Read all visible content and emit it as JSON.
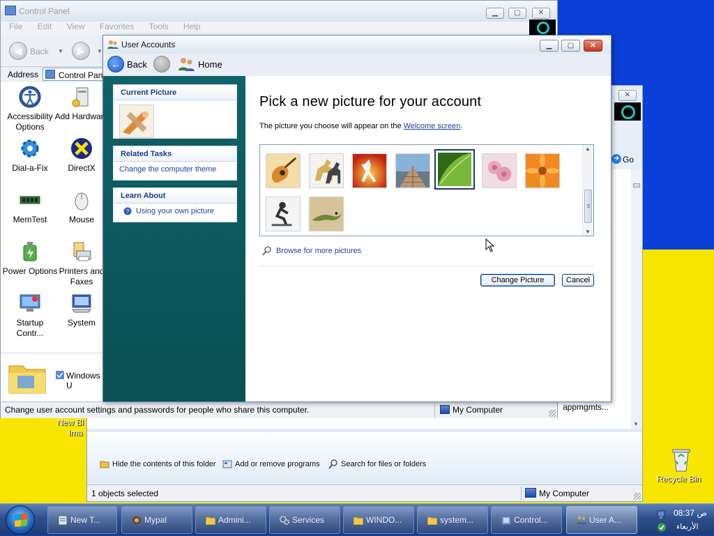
{
  "colors": {
    "desktop_top": "#0a3fd8",
    "desktop_bottom": "#f8e600",
    "sidebar_teal": "#0f6268",
    "link_blue": "#1f3f9a",
    "taskbar": "#2e4f8c"
  },
  "control_panel": {
    "title": "Control Panel",
    "menu": [
      "File",
      "Edit",
      "View",
      "Favorites",
      "Tools",
      "Help"
    ],
    "back_label": "Back",
    "address_label": "Address",
    "address_value": "Control Pan",
    "items": [
      {
        "label": "Accessibility Options",
        "icon": "accessibility-icon"
      },
      {
        "label": "Add Hardware",
        "icon": "add-hardware-icon"
      },
      {
        "label": "Dial-a-Fix",
        "icon": "dial-a-fix-icon"
      },
      {
        "label": "DirectX",
        "icon": "directx-icon"
      },
      {
        "label": "MemTest",
        "icon": "memtest-icon"
      },
      {
        "label": "Mouse",
        "icon": "mouse-icon"
      },
      {
        "label": "Power Options",
        "icon": "power-options-icon"
      },
      {
        "label": "Printers and Faxes",
        "icon": "printers-icon"
      },
      {
        "label": "Startup Contr...",
        "icon": "startup-icon"
      },
      {
        "label": "System",
        "icon": "system-icon"
      }
    ],
    "bottom_item": "Windows U",
    "status_text": "Change user account settings and passwords for people who share this computer.",
    "status_location": "My Computer"
  },
  "background_window": {
    "go_label": "Go",
    "list_item": "appmgmts...",
    "tasks": [
      {
        "label": "Hide the contents of this folder",
        "icon": "folder-icon"
      },
      {
        "label": "Add or remove programs",
        "icon": "programs-icon"
      },
      {
        "label": "Search for files or folders",
        "icon": "search-icon"
      }
    ],
    "status_text": "1 objects selected",
    "status_location": "My Computer"
  },
  "user_accounts": {
    "title": "User Accounts",
    "nav": {
      "back": "Back",
      "home": "Home"
    },
    "sidebar": {
      "current_picture_header": "Current Picture",
      "related_tasks_header": "Related Tasks",
      "related_tasks": [
        "Change the computer theme"
      ],
      "learn_about_header": "Learn About",
      "learn_about": [
        "Using your own picture"
      ]
    },
    "heading": "Pick a new picture for your account",
    "description_before": "The picture you choose will appear on the ",
    "description_link": "Welcome screen",
    "description_after": ".",
    "pictures": [
      {
        "name": "guitar",
        "selected": false
      },
      {
        "name": "horses",
        "selected": false
      },
      {
        "name": "karate",
        "selected": false
      },
      {
        "name": "pier",
        "selected": false
      },
      {
        "name": "leaf",
        "selected": true
      },
      {
        "name": "roses",
        "selected": false
      },
      {
        "name": "daisy",
        "selected": false
      },
      {
        "name": "skateboarder",
        "selected": false
      },
      {
        "name": "lizard",
        "selected": false
      }
    ],
    "browse_link": "Browse for more pictures",
    "buttons": {
      "change": "Change Picture",
      "cancel": "Cancel"
    }
  },
  "desktop": {
    "icon_label_1": "New Bl",
    "icon_label_2": "Ima",
    "recycle_bin": "Recycle Bin"
  },
  "taskbar": {
    "buttons": [
      {
        "label": "New T...",
        "icon": "notepad-icon",
        "active": false
      },
      {
        "label": "Mypal",
        "icon": "browser-icon",
        "active": false
      },
      {
        "label": "Admini...",
        "icon": "folder-icon",
        "active": false
      },
      {
        "label": "Services",
        "icon": "services-icon",
        "active": false
      },
      {
        "label": "WINDO...",
        "icon": "folder-icon",
        "active": false
      },
      {
        "label": "system...",
        "icon": "folder-icon",
        "active": false
      },
      {
        "label": "Control...",
        "icon": "control-panel-icon",
        "active": false
      },
      {
        "label": "User A...",
        "icon": "user-accounts-icon",
        "active": true
      }
    ],
    "time": "08:37 ص",
    "day": "الأربعاء"
  }
}
